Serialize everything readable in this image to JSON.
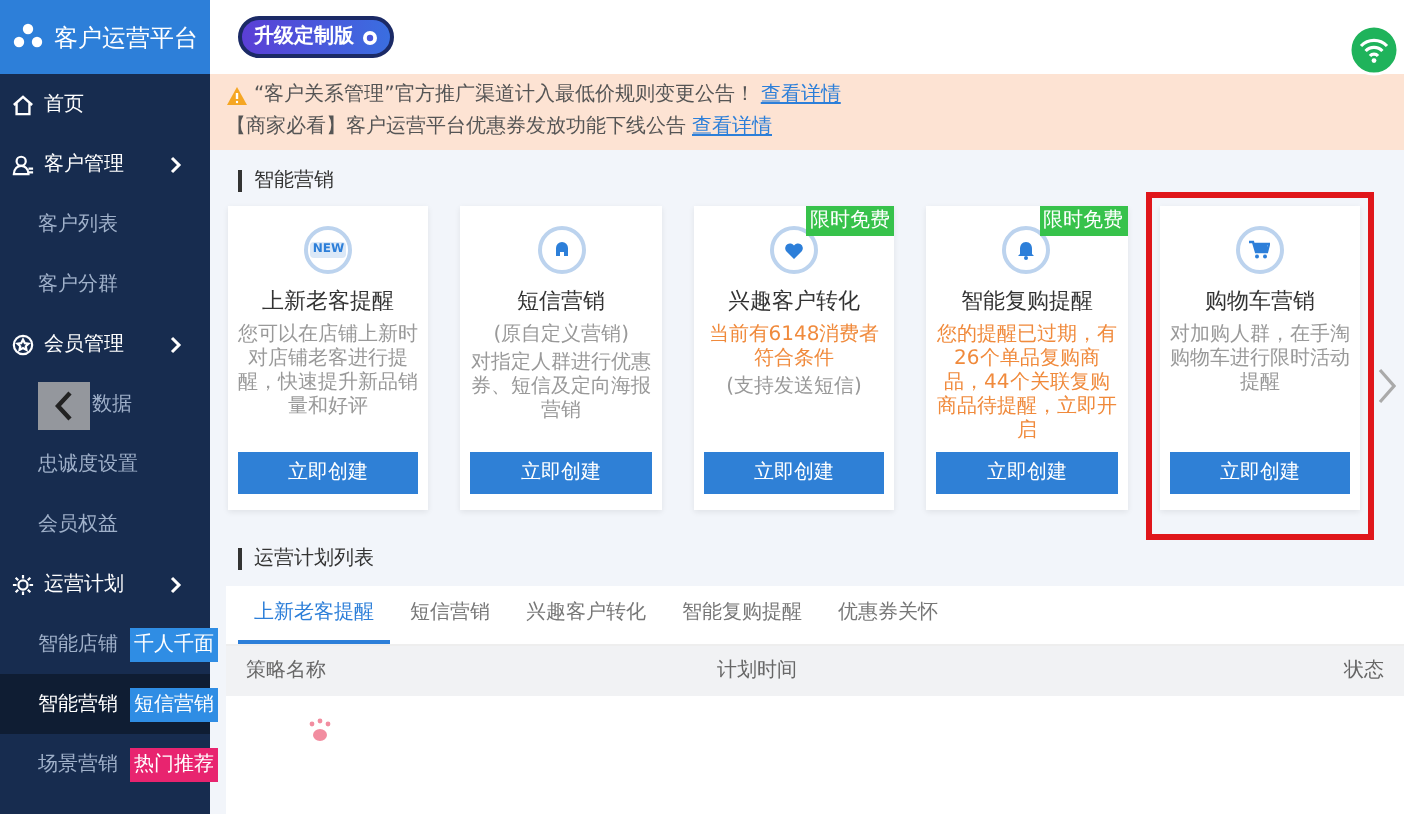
{
  "sidebar": {
    "title": "客户运营平台",
    "items": [
      {
        "label": "首页",
        "kind": "section",
        "expandable": false,
        "selected": false
      },
      {
        "label": "客户管理",
        "kind": "section",
        "expandable": true,
        "selected": false
      },
      {
        "label": "客户列表",
        "kind": "item",
        "selected": false
      },
      {
        "label": "客户分群",
        "kind": "item",
        "selected": false
      },
      {
        "label": "会员管理",
        "kind": "section",
        "expandable": true,
        "selected": false
      },
      {
        "label": "数据",
        "kind": "covered",
        "selected": false
      },
      {
        "label": "忠诚度设置",
        "kind": "item",
        "selected": false
      },
      {
        "label": "会员权益",
        "kind": "item",
        "selected": false
      },
      {
        "label": "运营计划",
        "kind": "section",
        "expandable": true,
        "selected": false
      },
      {
        "label": "智能店铺",
        "kind": "item",
        "selected": false,
        "badge": {
          "text": "千人千面",
          "color": "#2f8de4"
        }
      },
      {
        "label": "智能营销",
        "kind": "item",
        "selected": true,
        "badge": {
          "text": "短信营销",
          "color": "#2f8de4"
        }
      },
      {
        "label": "场景营销",
        "kind": "item",
        "selected": false,
        "badge": {
          "text": "热门推荐",
          "color": "#e8246f"
        }
      }
    ]
  },
  "topbar": {
    "upgrade_badge": "升级定制版"
  },
  "notices": [
    {
      "kind": "warning",
      "text": "“客户关系管理”官方推广渠道计入最低价规则变更公告！",
      "link": "查看详情"
    },
    {
      "kind": "plain",
      "text": "【商家必看】客户运营平台优惠券发放功能下线公告",
      "link": "查看详情"
    }
  ],
  "marketing": {
    "title": "智能营销",
    "cards": [
      {
        "title": "上新老客提醒",
        "icon_label": "NEW",
        "desc": [
          {
            "text": "您可以在店铺上新时对店铺老客进行提醒，快速提升新品销量和好评",
            "kind": "note"
          }
        ],
        "button": "立即创建",
        "highlighted": false
      },
      {
        "title": "短信营销",
        "desc": [
          {
            "text": "(原自定义营销)",
            "kind": "note"
          },
          {
            "text": "对指定人群进行优惠券、短信及定向海报营销",
            "kind": "note"
          }
        ],
        "button": "立即创建",
        "highlighted": false
      },
      {
        "title": "兴趣客户转化",
        "tag": "限时免费",
        "desc": [
          {
            "text": "当前有6148消费者符合条件",
            "kind": "alert"
          },
          {
            "text": "(支持发送短信)",
            "kind": "note"
          }
        ],
        "button": "立即创建",
        "highlighted": false
      },
      {
        "title": "智能复购提醒",
        "tag": "限时免费",
        "desc": [
          {
            "text": "您的提醒已过期，有26个单品复购商品，44个关联复购商品待提醒，立即开启",
            "kind": "alert"
          }
        ],
        "button": "立即创建",
        "highlighted": false
      },
      {
        "title": "购物车营销",
        "desc": [
          {
            "text": "对加购人群，在手淘购物车进行限时活动提醒",
            "kind": "note"
          }
        ],
        "button": "立即创建",
        "highlighted": true
      }
    ]
  },
  "plans": {
    "title": "运营计划列表",
    "tabs": [
      {
        "label": "上新老客提醒",
        "selected": true
      },
      {
        "label": "短信营销",
        "selected": false
      },
      {
        "label": "兴趣客户转化",
        "selected": false
      },
      {
        "label": "智能复购提醒",
        "selected": false
      },
      {
        "label": "优惠券关怀",
        "selected": false
      }
    ],
    "columns": [
      "策略名称",
      "计划时间",
      "状态"
    ]
  }
}
